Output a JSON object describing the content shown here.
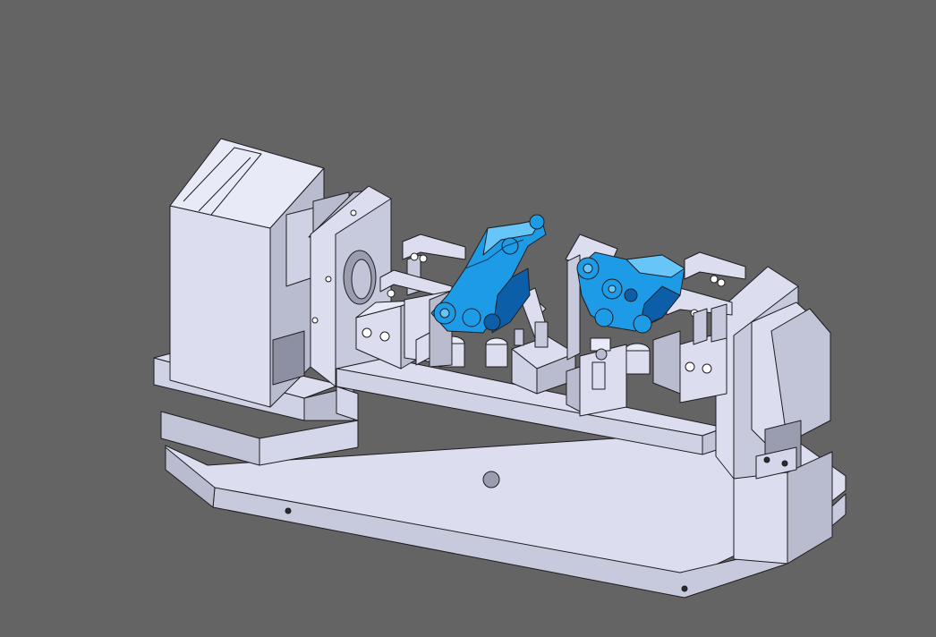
{
  "viewport": {
    "background_color": "#646464"
  },
  "model": {
    "body_color": "#dcdef0",
    "side_shade_color": "#b9bccf",
    "dark_shade_color": "#8d90a3",
    "edge_color": "#1e1e22",
    "part_color": "#1e9be6",
    "part_highlight_color": "#67c6f7",
    "part_dark_color": "#0d5ea8"
  }
}
